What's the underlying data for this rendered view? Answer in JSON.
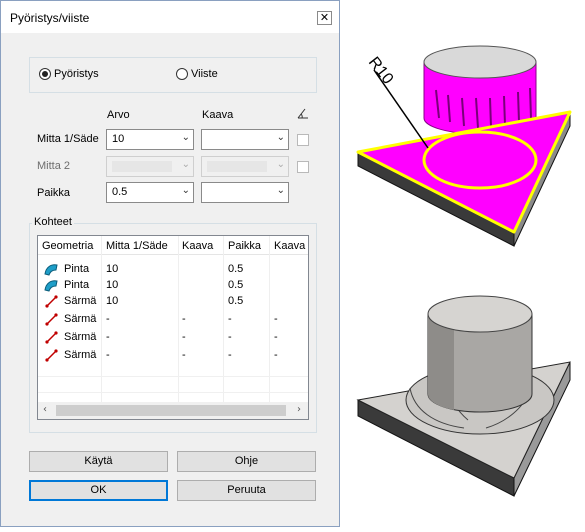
{
  "dialog": {
    "title": "Pyöristys/viiste",
    "close": "✕"
  },
  "mode": {
    "options": [
      {
        "label": "Pyöristys",
        "selected": true
      },
      {
        "label": "Viiste",
        "selected": false
      }
    ]
  },
  "params": {
    "col_arvo": "Arvo",
    "col_kaava": "Kaava",
    "rows": [
      {
        "label": "Mitta 1/Säde",
        "value": "10",
        "enabled": true
      },
      {
        "label": "Mitta 2",
        "value": "",
        "enabled": false
      },
      {
        "label": "Paikka",
        "value": "0.5",
        "enabled": true
      }
    ]
  },
  "targets": {
    "group_label": "Kohteet",
    "columns": [
      "Geometria",
      "Mitta 1/Säde",
      "Kaava",
      "Paikka",
      "Kaava"
    ],
    "rows": [
      {
        "type": "surface",
        "geometry": "Pinta",
        "dim": "10",
        "formula": "",
        "place": "0.5",
        "formula2": ""
      },
      {
        "type": "surface",
        "geometry": "Pinta",
        "dim": "10",
        "formula": "",
        "place": "0.5",
        "formula2": ""
      },
      {
        "type": "edge",
        "geometry": "Särmä",
        "dim": "10",
        "formula": "",
        "place": "0.5",
        "formula2": ""
      },
      {
        "type": "edge",
        "geometry": "Särmä",
        "dim": "-",
        "formula": "-",
        "place": "-",
        "formula2": "-"
      },
      {
        "type": "edge",
        "geometry": "Särmä",
        "dim": "-",
        "formula": "-",
        "place": "-",
        "formula2": "-"
      },
      {
        "type": "edge",
        "geometry": "Särmä",
        "dim": "-",
        "formula": "-",
        "place": "-",
        "formula2": "-"
      }
    ]
  },
  "buttons": {
    "apply": "Käytä",
    "help": "Ohje",
    "ok": "OK",
    "cancel": "Peruuta"
  },
  "figure": {
    "dimension_label": "R10",
    "highlight_color": "#ff00ff",
    "edge_color": "#ffff00"
  }
}
